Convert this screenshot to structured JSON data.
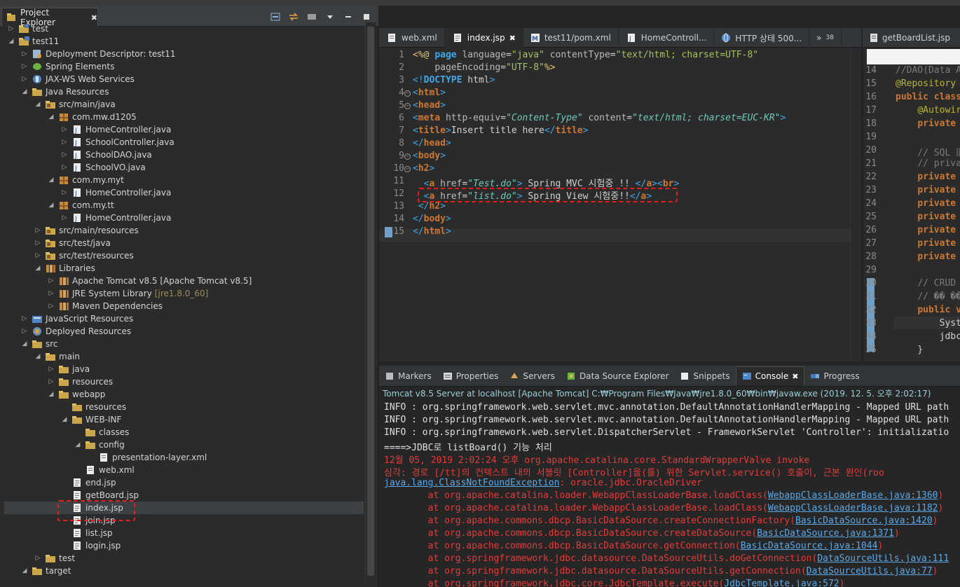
{
  "project_explorer": {
    "tab_label": "Project Explorer",
    "tree": [
      {
        "label": "test",
        "depth": 0,
        "arrow": "right",
        "icon": "project-icon"
      },
      {
        "label": "test11",
        "depth": 0,
        "arrow": "down",
        "icon": "web-project-icon"
      },
      {
        "label": "Deployment Descriptor: test11",
        "depth": 1,
        "arrow": "right",
        "icon": "descriptor-icon"
      },
      {
        "label": "Spring Elements",
        "depth": 1,
        "arrow": "right",
        "icon": "spring-icon"
      },
      {
        "label": "JAX-WS Web Services",
        "depth": 1,
        "arrow": "right",
        "icon": "webservice-icon"
      },
      {
        "label": "Java Resources",
        "depth": 1,
        "arrow": "down",
        "icon": "java-resources-icon"
      },
      {
        "label": "src/main/java",
        "depth": 2,
        "arrow": "down",
        "icon": "source-folder-icon"
      },
      {
        "label": "com.mw.d1205",
        "depth": 3,
        "arrow": "down",
        "icon": "package-icon"
      },
      {
        "label": "HomeController.java",
        "depth": 4,
        "arrow": "right",
        "icon": "java-file-icon"
      },
      {
        "label": "SchoolController.java",
        "depth": 4,
        "arrow": "right",
        "icon": "java-file-icon"
      },
      {
        "label": "SchoolDAO.java",
        "depth": 4,
        "arrow": "right",
        "icon": "java-file-icon"
      },
      {
        "label": "SchoolVO.java",
        "depth": 4,
        "arrow": "right",
        "icon": "java-file-icon"
      },
      {
        "label": "com.my.myt",
        "depth": 3,
        "arrow": "down",
        "icon": "package-icon"
      },
      {
        "label": "HomeController.java",
        "depth": 4,
        "arrow": "right",
        "icon": "java-file-icon"
      },
      {
        "label": "com.my.tt",
        "depth": 3,
        "arrow": "down",
        "icon": "package-icon"
      },
      {
        "label": "HomeController.java",
        "depth": 4,
        "arrow": "right",
        "icon": "java-file-icon"
      },
      {
        "label": "src/main/resources",
        "depth": 2,
        "arrow": "right",
        "icon": "source-folder-icon"
      },
      {
        "label": "src/test/java",
        "depth": 2,
        "arrow": "right",
        "icon": "source-folder-icon"
      },
      {
        "label": "src/test/resources",
        "depth": 2,
        "arrow": "right",
        "icon": "source-folder-icon"
      },
      {
        "label": "Libraries",
        "depth": 2,
        "arrow": "down",
        "icon": "library-icon"
      },
      {
        "label": "Apache Tomcat v8.5 [Apache Tomcat v8.5]",
        "depth": 3,
        "arrow": "right",
        "icon": "library-icon"
      },
      {
        "label": "JRE System Library",
        "extra": "[jre1.8.0_60]",
        "depth": 3,
        "arrow": "right",
        "icon": "library-icon"
      },
      {
        "label": "Maven Dependencies",
        "depth": 3,
        "arrow": "right",
        "icon": "library-icon"
      },
      {
        "label": "JavaScript Resources",
        "depth": 1,
        "arrow": "right",
        "icon": "js-resources-icon"
      },
      {
        "label": "Deployed Resources",
        "depth": 1,
        "arrow": "right",
        "icon": "deployed-icon"
      },
      {
        "label": "src",
        "depth": 1,
        "arrow": "down",
        "icon": "folder-icon"
      },
      {
        "label": "main",
        "depth": 2,
        "arrow": "down",
        "icon": "folder-icon"
      },
      {
        "label": "java",
        "depth": 3,
        "arrow": "right",
        "icon": "folder-icon"
      },
      {
        "label": "resources",
        "depth": 3,
        "arrow": "right",
        "icon": "folder-icon"
      },
      {
        "label": "webapp",
        "depth": 3,
        "arrow": "down",
        "icon": "folder-icon"
      },
      {
        "label": "resources",
        "depth": 4,
        "arrow": "none",
        "icon": "folder-icon"
      },
      {
        "label": "WEB-INF",
        "depth": 4,
        "arrow": "down",
        "icon": "folder-icon"
      },
      {
        "label": "classes",
        "depth": 5,
        "arrow": "none",
        "icon": "folder-icon"
      },
      {
        "label": "config",
        "depth": 5,
        "arrow": "down",
        "icon": "folder-icon"
      },
      {
        "label": "presentation-layer.xml",
        "depth": 6,
        "arrow": "none",
        "icon": "xml-file-icon"
      },
      {
        "label": "web.xml",
        "depth": 5,
        "arrow": "none",
        "icon": "xml-file-icon"
      },
      {
        "label": "end.jsp",
        "depth": 4,
        "arrow": "none",
        "icon": "jsp-file-icon"
      },
      {
        "label": "getBoard.jsp",
        "depth": 4,
        "arrow": "none",
        "icon": "jsp-file-icon"
      },
      {
        "label": "index.jsp",
        "depth": 4,
        "arrow": "none",
        "icon": "jsp-file-icon",
        "selected": true
      },
      {
        "label": "join.jsp",
        "depth": 4,
        "arrow": "none",
        "icon": "jsp-file-icon"
      },
      {
        "label": "list.jsp",
        "depth": 4,
        "arrow": "none",
        "icon": "jsp-file-icon"
      },
      {
        "label": "login.jsp",
        "depth": 4,
        "arrow": "none",
        "icon": "jsp-file-icon"
      },
      {
        "label": "test",
        "depth": 2,
        "arrow": "right",
        "icon": "folder-icon"
      },
      {
        "label": "target",
        "depth": 1,
        "arrow": "down",
        "icon": "folder-icon"
      }
    ]
  },
  "editor": {
    "tabs": [
      {
        "label": "web.xml",
        "icon": "xml-file-icon",
        "active": false
      },
      {
        "label": "index.jsp",
        "icon": "jsp-file-icon",
        "active": true,
        "close": "✖"
      },
      {
        "label": "test11/pom.xml",
        "icon": "maven-icon",
        "active": false
      },
      {
        "label": "HomeControll...",
        "icon": "java-file-icon",
        "active": false
      },
      {
        "label": "HTTP 상태 500...",
        "icon": "globe-icon",
        "active": false
      }
    ],
    "overflow_label": "»",
    "overflow_count": "38",
    "lines": [
      {
        "n": "1",
        "fold": false,
        "html": "<span class='dt'>&lt;%@</span> <span class='kw' style='color:#3fa8e6'>page</span> <span class='at'>language</span>=<span class='sv'>\"java\"</span> <span class='at'>contentType</span>=<span class='sv'>\"text/html; charset=UTF-8\"</span>"
      },
      {
        "n": "2",
        "fold": false,
        "html": "    <span class='at'>pageEncoding</span>=<span class='sv'>\"UTF-8\"</span><span class='dt'>%&gt;</span>"
      },
      {
        "n": "3",
        "fold": false,
        "html": "<span class='tg'>&lt;!</span><span class='kw' style='color:#3fa8e6'>DOCTYPE</span> html<span class='tg'>&gt;</span>"
      },
      {
        "n": "4",
        "fold": true,
        "html": "<span class='tg'>&lt;</span><span class='kw'>html</span><span class='tg'>&gt;</span>"
      },
      {
        "n": "5",
        "fold": true,
        "html": "<span class='tg'>&lt;</span><span class='kw'>head</span><span class='tg'>&gt;</span>"
      },
      {
        "n": "6",
        "fold": false,
        "html": "<span class='tg'>&lt;</span><span class='kw'>meta</span> <span class='at'>http-equiv</span>=<span class='st'>\"Content-Type\"</span> <span class='at'>content</span>=<span class='st'>\"text/html; charset=EUC-KR\"</span><span class='tg'>&gt;</span>"
      },
      {
        "n": "7",
        "fold": false,
        "html": "<span class='tg'>&lt;</span><span class='kw'>title</span><span class='tg'>&gt;</span>Insert title here<span class='tg'>&lt;/</span><span class='kw'>title</span><span class='tg'>&gt;</span>"
      },
      {
        "n": "8",
        "fold": false,
        "html": "<span class='tg'>&lt;/</span><span class='kw'>head</span><span class='tg'>&gt;</span>"
      },
      {
        "n": "9",
        "fold": true,
        "html": "<span class='tg'>&lt;</span><span class='kw'>body</span><span class='tg'>&gt;</span>"
      },
      {
        "n": "10",
        "fold": true,
        "html": "<span class='tg'>&lt;</span><span class='kw'>h2</span><span class='tg'>&gt;</span>"
      },
      {
        "n": "11",
        "fold": false,
        "html": "  <span class='tg'>&lt;</span><span class='kw'>a</span> <span class='at'>href</span>=<span class='st'>\"Test.do\"</span><span class='tg'>&gt;</span> Spring MVC 시험중 !! <span class='tg'>&lt;/</span><span class='kw'>a</span><span class='tg'>&gt;&lt;</span><span class='kw'>br</span><span class='tg'>&gt;</span>"
      },
      {
        "n": "12",
        "fold": false,
        "html": "  <span class='tg'>&lt;</span><span class='kw'>a</span> <span class='at'>href</span>=<span class='st'>\"list.do\"</span><span class='tg'>&gt;</span> Spring View 시험중!!<span class='tg'>&lt;/</span><span class='kw'>a</span><span class='tg'>&gt;</span>"
      },
      {
        "n": "13",
        "fold": false,
        "html": " <span class='tg'>&lt;/</span><span class='kw'>h2</span><span class='tg'>&gt;</span>"
      },
      {
        "n": "14",
        "fold": false,
        "html": "<span class='tg'>&lt;/</span><span class='kw'>body</span><span class='tg'>&gt;</span>"
      },
      {
        "n": "15",
        "fold": false,
        "html": "<span class='tg'>&lt;/</span><span class='kw'>html</span><span class='tg'>&gt;</span>"
      }
    ]
  },
  "right_editor": {
    "tab_label": "getBoardList.jsp",
    "lines": [
      {
        "n": "14",
        "html": "<span style='color:#7a7a7a'>//DAO(Data A</span>"
      },
      {
        "n": "15",
        "html": "<span style='color:#bbb529'>@Repository</span>"
      },
      {
        "n": "16",
        "html": "<span class='kw'>public class</span>"
      },
      {
        "n": "17",
        "html": "    <span style='color:#bbb529'>@Autowir</span>"
      },
      {
        "n": "18",
        "html": "    <span class='kw'>private</span>"
      },
      {
        "n": "19",
        "html": ""
      },
      {
        "n": "20",
        "html": "    <span style='color:#7a7a7a'>// SQL </span><span style='color:#7a7a7a'>旧</span>"
      },
      {
        "n": "21",
        "html": "    <span style='color:#7a7a7a'>// priva</span>"
      },
      {
        "n": "22",
        "html": "    <span class='kw'>private</span>"
      },
      {
        "n": "23",
        "html": "    <span class='kw'>private</span>"
      },
      {
        "n": "24",
        "html": "    <span class='kw'>private</span>"
      },
      {
        "n": "25",
        "html": "    <span class='kw'>private</span>"
      },
      {
        "n": "26",
        "html": "    <span class='kw'>private</span>"
      },
      {
        "n": "27",
        "html": "    <span class='kw'>private</span>"
      },
      {
        "n": "28",
        "html": "    <span class='kw'>private</span>"
      },
      {
        "n": "29",
        "html": ""
      },
      {
        "n": "30",
        "html": "    <span style='color:#7a7a7a'>// CRUD</span>"
      },
      {
        "n": "31",
        "html": "    <span style='color:#7a7a7a'>// �� ��</span>"
      },
      {
        "n": "32",
        "html": "    <span class='kw'>public v</span>"
      },
      {
        "n": "33",
        "html": "        Syst"
      },
      {
        "n": "34",
        "html": "        jdbc"
      },
      {
        "n": "35",
        "html": "    }"
      }
    ]
  },
  "console": {
    "tabs": [
      {
        "label": "Markers",
        "icon": "markers-icon",
        "active": false
      },
      {
        "label": "Properties",
        "icon": "properties-icon",
        "active": false
      },
      {
        "label": "Servers",
        "icon": "servers-icon",
        "active": false
      },
      {
        "label": "Data Source Explorer",
        "icon": "datasource-icon",
        "active": false
      },
      {
        "label": "Snippets",
        "icon": "snippets-icon",
        "active": false
      },
      {
        "label": "Console",
        "icon": "console-icon",
        "active": true,
        "close": "✖"
      },
      {
        "label": "Progress",
        "icon": "progress-icon",
        "active": false
      }
    ],
    "description": "Tomcat v8.5 Server at localhost [Apache Tomcat] C:₩Program Files₩Java₩jre1.8.0_60₩bin₩javaw.exe (2019. 12. 5. 오후 2:02:17)",
    "lines": [
      {
        "html": "INFO : org.springframework.web.servlet.mvc.annotation.DefaultAnnotationHandlerMapping - Mapped URL path"
      },
      {
        "html": "INFO : org.springframework.web.servlet.mvc.annotation.DefaultAnnotationHandlerMapping - Mapped URL path"
      },
      {
        "html": "INFO : org.springframework.web.servlet.DispatcherServlet - FrameworkServlet 'Controller': initializatio"
      },
      {
        "html": "====>JDBC로 listBoard() 기능 처리"
      },
      {
        "html": "<span class='red'>12월 05, 2019 2:02:24 오후 org.apache.catalina.core.StandardWrapperValve invoke</span>"
      },
      {
        "html": "<span class='red'>심각: 경로 [/tt]의 컨텍스트 내의 서블릿 [Controller]을(를) 위한 Servlet.service() 호출이, 근본 원인(roo</span>"
      },
      {
        "html": "<span class='lnk'>java.lang.ClassNotFoundException</span><span class='red'>: oracle.jdbc.OracleDriver</span>"
      },
      {
        "html": "<span class='red'>        at org.apache.catalina.loader.WebappClassLoaderBase.loadClass(</span><span class='lnk'>WebappClassLoaderBase.java:1360</span><span class='red'>)</span>"
      },
      {
        "html": "<span class='red'>        at org.apache.catalina.loader.WebappClassLoaderBase.loadClass(</span><span class='lnk'>WebappClassLoaderBase.java:1182</span><span class='red'>)</span>"
      },
      {
        "html": "<span class='red'>        at org.apache.commons.dbcp.BasicDataSource.createConnectionFactory(</span><span class='lnk'>BasicDataSource.java:1420</span><span class='red'>)</span>"
      },
      {
        "html": "<span class='red'>        at org.apache.commons.dbcp.BasicDataSource.createDataSource(</span><span class='lnk'>BasicDataSource.java:1371</span><span class='red'>)</span>"
      },
      {
        "html": "<span class='red'>        at org.apache.commons.dbcp.BasicDataSource.getConnection(</span><span class='lnk'>BasicDataSource.java:1044</span><span class='red'>)</span>"
      },
      {
        "html": "<span class='red'>        at org.springframework.jdbc.datasource.DataSourceUtils.doGetConnection(</span><span class='lnk'>DataSourceUtils.java:111</span>"
      },
      {
        "html": "<span class='red'>        at org.springframework.jdbc.datasource.DataSourceUtils.getConnection(</span><span class='lnk'>DataSourceUtils.java:77</span><span class='red'>)</span>"
      },
      {
        "html": "<span class='red'>        at org.springframework.jdbc.core.JdbcTemplate.execute(</span><span class='lnk'>JdbcTemplate.java:572</span><span class='red'>)</span>"
      }
    ]
  },
  "colors": {
    "annotation_red": "#e02020",
    "keyword": "#cc7832",
    "tag": "#3fa8e6",
    "string": "#6fc9b8",
    "error": "#e33b3b",
    "link": "#5ba9e8"
  }
}
